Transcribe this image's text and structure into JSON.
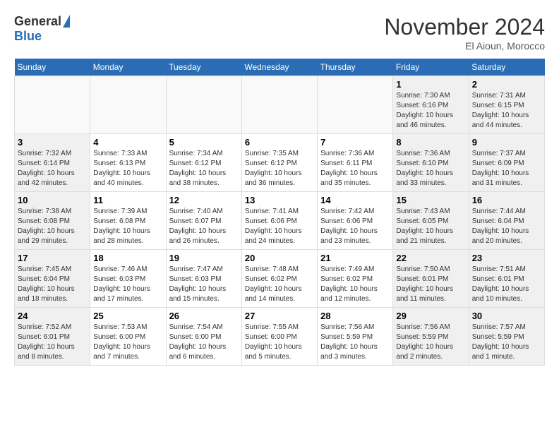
{
  "header": {
    "logo_general": "General",
    "logo_blue": "Blue",
    "month_title": "November 2024",
    "location": "El Aioun, Morocco"
  },
  "days_of_week": [
    "Sunday",
    "Monday",
    "Tuesday",
    "Wednesday",
    "Thursday",
    "Friday",
    "Saturday"
  ],
  "weeks": [
    [
      {
        "day": "",
        "info": "",
        "type": "empty"
      },
      {
        "day": "",
        "info": "",
        "type": "empty"
      },
      {
        "day": "",
        "info": "",
        "type": "empty"
      },
      {
        "day": "",
        "info": "",
        "type": "empty"
      },
      {
        "day": "",
        "info": "",
        "type": "empty"
      },
      {
        "day": "1",
        "info": "Sunrise: 7:30 AM\nSunset: 6:16 PM\nDaylight: 10 hours and 46 minutes.",
        "type": "weekend"
      },
      {
        "day": "2",
        "info": "Sunrise: 7:31 AM\nSunset: 6:15 PM\nDaylight: 10 hours and 44 minutes.",
        "type": "weekend"
      }
    ],
    [
      {
        "day": "3",
        "info": "Sunrise: 7:32 AM\nSunset: 6:14 PM\nDaylight: 10 hours and 42 minutes.",
        "type": "weekend"
      },
      {
        "day": "4",
        "info": "Sunrise: 7:33 AM\nSunset: 6:13 PM\nDaylight: 10 hours and 40 minutes.",
        "type": "weekday"
      },
      {
        "day": "5",
        "info": "Sunrise: 7:34 AM\nSunset: 6:12 PM\nDaylight: 10 hours and 38 minutes.",
        "type": "weekday"
      },
      {
        "day": "6",
        "info": "Sunrise: 7:35 AM\nSunset: 6:12 PM\nDaylight: 10 hours and 36 minutes.",
        "type": "weekday"
      },
      {
        "day": "7",
        "info": "Sunrise: 7:36 AM\nSunset: 6:11 PM\nDaylight: 10 hours and 35 minutes.",
        "type": "weekday"
      },
      {
        "day": "8",
        "info": "Sunrise: 7:36 AM\nSunset: 6:10 PM\nDaylight: 10 hours and 33 minutes.",
        "type": "weekend"
      },
      {
        "day": "9",
        "info": "Sunrise: 7:37 AM\nSunset: 6:09 PM\nDaylight: 10 hours and 31 minutes.",
        "type": "weekend"
      }
    ],
    [
      {
        "day": "10",
        "info": "Sunrise: 7:38 AM\nSunset: 6:08 PM\nDaylight: 10 hours and 29 minutes.",
        "type": "weekend"
      },
      {
        "day": "11",
        "info": "Sunrise: 7:39 AM\nSunset: 6:08 PM\nDaylight: 10 hours and 28 minutes.",
        "type": "weekday"
      },
      {
        "day": "12",
        "info": "Sunrise: 7:40 AM\nSunset: 6:07 PM\nDaylight: 10 hours and 26 minutes.",
        "type": "weekday"
      },
      {
        "day": "13",
        "info": "Sunrise: 7:41 AM\nSunset: 6:06 PM\nDaylight: 10 hours and 24 minutes.",
        "type": "weekday"
      },
      {
        "day": "14",
        "info": "Sunrise: 7:42 AM\nSunset: 6:06 PM\nDaylight: 10 hours and 23 minutes.",
        "type": "weekday"
      },
      {
        "day": "15",
        "info": "Sunrise: 7:43 AM\nSunset: 6:05 PM\nDaylight: 10 hours and 21 minutes.",
        "type": "weekend"
      },
      {
        "day": "16",
        "info": "Sunrise: 7:44 AM\nSunset: 6:04 PM\nDaylight: 10 hours and 20 minutes.",
        "type": "weekend"
      }
    ],
    [
      {
        "day": "17",
        "info": "Sunrise: 7:45 AM\nSunset: 6:04 PM\nDaylight: 10 hours and 18 minutes.",
        "type": "weekend"
      },
      {
        "day": "18",
        "info": "Sunrise: 7:46 AM\nSunset: 6:03 PM\nDaylight: 10 hours and 17 minutes.",
        "type": "weekday"
      },
      {
        "day": "19",
        "info": "Sunrise: 7:47 AM\nSunset: 6:03 PM\nDaylight: 10 hours and 15 minutes.",
        "type": "weekday"
      },
      {
        "day": "20",
        "info": "Sunrise: 7:48 AM\nSunset: 6:02 PM\nDaylight: 10 hours and 14 minutes.",
        "type": "weekday"
      },
      {
        "day": "21",
        "info": "Sunrise: 7:49 AM\nSunset: 6:02 PM\nDaylight: 10 hours and 12 minutes.",
        "type": "weekday"
      },
      {
        "day": "22",
        "info": "Sunrise: 7:50 AM\nSunset: 6:01 PM\nDaylight: 10 hours and 11 minutes.",
        "type": "weekend"
      },
      {
        "day": "23",
        "info": "Sunrise: 7:51 AM\nSunset: 6:01 PM\nDaylight: 10 hours and 10 minutes.",
        "type": "weekend"
      }
    ],
    [
      {
        "day": "24",
        "info": "Sunrise: 7:52 AM\nSunset: 6:01 PM\nDaylight: 10 hours and 8 minutes.",
        "type": "weekend"
      },
      {
        "day": "25",
        "info": "Sunrise: 7:53 AM\nSunset: 6:00 PM\nDaylight: 10 hours and 7 minutes.",
        "type": "weekday"
      },
      {
        "day": "26",
        "info": "Sunrise: 7:54 AM\nSunset: 6:00 PM\nDaylight: 10 hours and 6 minutes.",
        "type": "weekday"
      },
      {
        "day": "27",
        "info": "Sunrise: 7:55 AM\nSunset: 6:00 PM\nDaylight: 10 hours and 5 minutes.",
        "type": "weekday"
      },
      {
        "day": "28",
        "info": "Sunrise: 7:56 AM\nSunset: 5:59 PM\nDaylight: 10 hours and 3 minutes.",
        "type": "weekday"
      },
      {
        "day": "29",
        "info": "Sunrise: 7:56 AM\nSunset: 5:59 PM\nDaylight: 10 hours and 2 minutes.",
        "type": "weekend"
      },
      {
        "day": "30",
        "info": "Sunrise: 7:57 AM\nSunset: 5:59 PM\nDaylight: 10 hours and 1 minute.",
        "type": "weekend"
      }
    ]
  ]
}
